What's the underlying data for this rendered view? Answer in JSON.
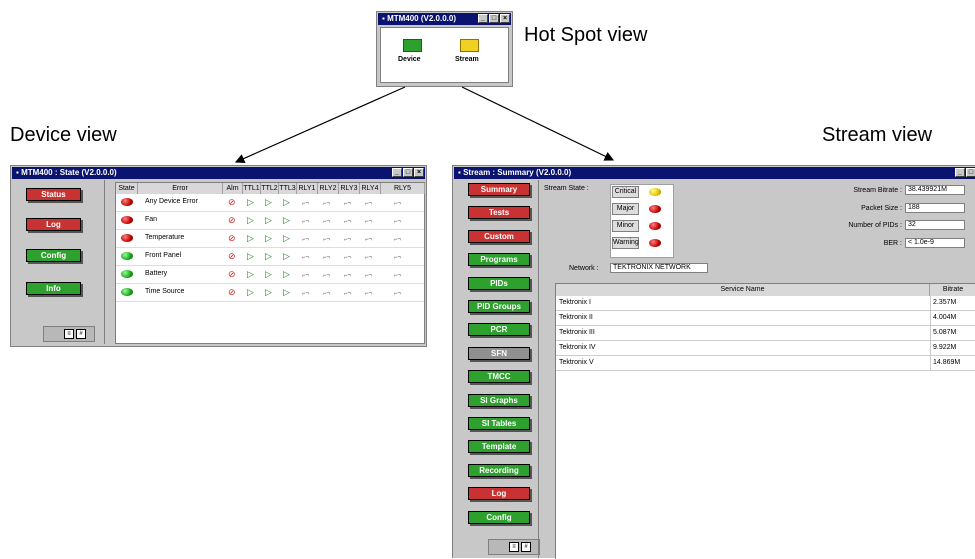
{
  "hotspot": {
    "title": "MTM400 (V2.0.0.0)",
    "items": [
      {
        "label": "Device",
        "color": "#2ea02e"
      },
      {
        "label": "Stream",
        "color": "#f0d020"
      }
    ],
    "caption": "Hot Spot view"
  },
  "device_caption": "Device view",
  "stream_caption": "Stream view",
  "device": {
    "title": "MTM400 : State (V2.0.0.0)",
    "nav": [
      "Status",
      "Log",
      "Config",
      "Info"
    ],
    "columns": [
      "State",
      "Error",
      "Alm",
      "TTL1",
      "TTL2",
      "TTL3",
      "RLY1",
      "RLY2",
      "RLY3",
      "RLY4",
      "RLY5"
    ],
    "rows": [
      {
        "state": "red",
        "error": "Any Device Error"
      },
      {
        "state": "red",
        "error": "Fan"
      },
      {
        "state": "red",
        "error": "Temperature"
      },
      {
        "state": "green",
        "error": "Front Panel"
      },
      {
        "state": "green",
        "error": "Battery"
      },
      {
        "state": "green",
        "error": "Time Source"
      }
    ]
  },
  "stream": {
    "title": "Stream : Summary (V2.0.0.0)",
    "nav": [
      {
        "label": "Summary",
        "color": "red"
      },
      {
        "label": "Tests",
        "color": "red"
      },
      {
        "label": "Custom",
        "color": "red"
      },
      {
        "label": "Programs",
        "color": "green"
      },
      {
        "label": "PIDs",
        "color": "green"
      },
      {
        "label": "PID Groups",
        "color": "green"
      },
      {
        "label": "PCR",
        "color": "green"
      },
      {
        "label": "SFN",
        "color": "grey"
      },
      {
        "label": "TMCC",
        "color": "green"
      },
      {
        "label": "SI Graphs",
        "color": "green"
      },
      {
        "label": "SI Tables",
        "color": "green"
      },
      {
        "label": "Template",
        "color": "green"
      },
      {
        "label": "Recording",
        "color": "green"
      },
      {
        "label": "Log",
        "color": "red"
      },
      {
        "label": "Config",
        "color": "green"
      }
    ],
    "state_label": "Stream State :",
    "states": [
      {
        "label": "Critical",
        "led": "y"
      },
      {
        "label": "Major",
        "led": "r"
      },
      {
        "label": "Minor",
        "led": "r"
      },
      {
        "label": "Warning",
        "led": "r"
      }
    ],
    "metrics": [
      {
        "label": "Stream Bitrate :",
        "value": "38.439921M"
      },
      {
        "label": "Packet Size :",
        "value": "188"
      },
      {
        "label": "Number of PIDs :",
        "value": "32"
      },
      {
        "label": "BER :",
        "value": "< 1.0e-9"
      }
    ],
    "network_label": "Network :",
    "network_value": "TEKTRONIX NETWORK",
    "table": {
      "headers": [
        "Service Name",
        "Bitrate"
      ],
      "rows": [
        [
          "Tektronix I",
          "2.357M"
        ],
        [
          "Tektronix II",
          "4.004M"
        ],
        [
          "Tektronix III",
          "5.087M"
        ],
        [
          "Tektronix IV",
          "9.922M"
        ],
        [
          "Tektronix V",
          "14.869M"
        ]
      ]
    }
  }
}
